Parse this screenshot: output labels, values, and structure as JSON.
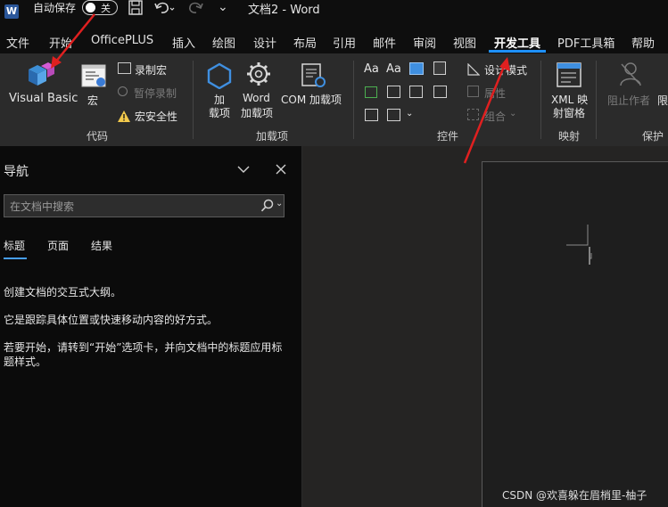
{
  "title_bar": {
    "autosave_label": "自动保存",
    "autosave_state": "关",
    "doc_title": "文档2 - Word",
    "more_glyph": "⌄"
  },
  "tabs": [
    "文件",
    "开始",
    "OfficePLUS",
    "插入",
    "绘图",
    "设计",
    "布局",
    "引用",
    "邮件",
    "审阅",
    "视图",
    "开发工具",
    "PDF工具箱",
    "帮助"
  ],
  "active_tab": "开发工具",
  "ribbon": {
    "code": {
      "label": "代码",
      "visual_basic": "Visual Basic",
      "macros": "宏",
      "record_macro": "录制宏",
      "pause_recording": "暂停录制",
      "macro_security": "宏安全性"
    },
    "addins": {
      "label": "加载项",
      "addins_line1": "加",
      "addins_line2": "载项",
      "word_addins_line1": "Word",
      "word_addins_line2": "加载项",
      "com_addins": "COM 加载项"
    },
    "controls": {
      "label": "控件",
      "aa1": "Aa",
      "aa2": "Aa",
      "design_mode": "设计模式",
      "properties": "属性",
      "group": "组合"
    },
    "mapping": {
      "label": "映射",
      "xml_line1": "XML 映",
      "xml_line2": "射窗格"
    },
    "protect": {
      "label": "保护",
      "block_authors_line1": "阻止作者",
      "restrict_partial": "限"
    }
  },
  "navigation": {
    "title": "导航",
    "search_placeholder": "在文档中搜索",
    "tabs": [
      "标题",
      "页面",
      "结果"
    ],
    "messages": [
      "创建文档的交互式大纲。",
      "它是跟踪具体位置或快速移动内容的好方式。",
      "若要开始，请转到“开始”选项卡，并向文档中的标题应用标题样式。"
    ]
  },
  "watermark": "CSDN @欢喜躲在眉梢里-柚子",
  "colors": {
    "accent": "#1e90ff",
    "annotation_arrow": "#e02020",
    "background": "#1b1b1b",
    "ribbon": "#2b2b2b",
    "word_blue": "#2b579a"
  }
}
